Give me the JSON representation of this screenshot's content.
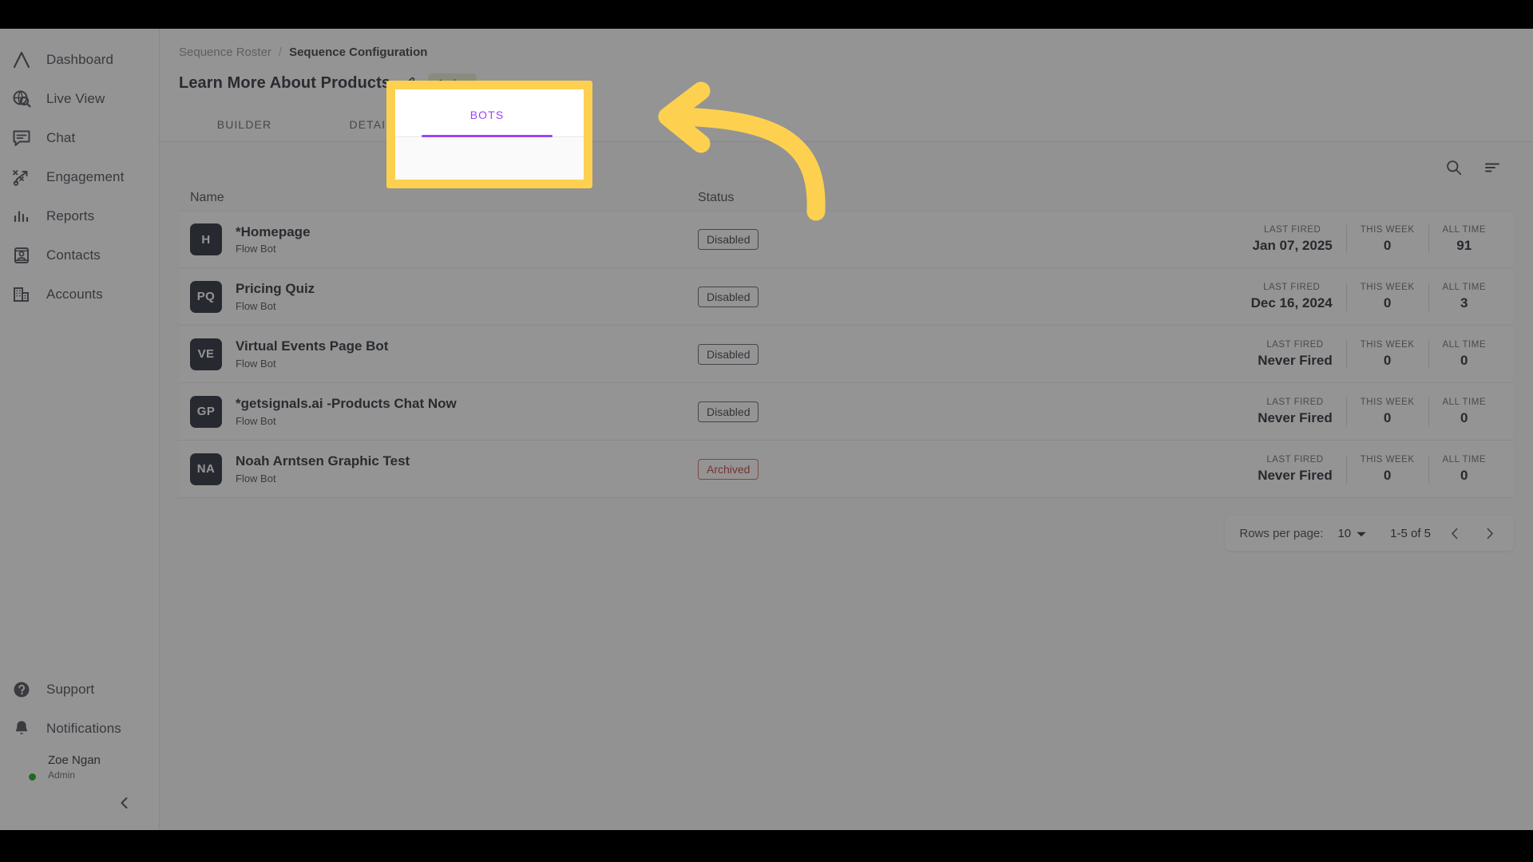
{
  "theme": {
    "accent_purple": "#9b45f5",
    "highlight_yellow": "#fdd14f",
    "active_badge_green": "#4b7a19",
    "archived_red": "#c0392b",
    "online_dot_green": "#12a312"
  },
  "sidebar": {
    "items": [
      {
        "label": "Dashboard",
        "icon": "chevron-up-logo-icon"
      },
      {
        "label": "Live View",
        "icon": "globe-search-icon"
      },
      {
        "label": "Chat",
        "icon": "chat-bubble-icon"
      },
      {
        "label": "Engagement",
        "icon": "engagement-path-icon"
      },
      {
        "label": "Reports",
        "icon": "bar-chart-icon"
      },
      {
        "label": "Contacts",
        "icon": "contact-card-icon"
      },
      {
        "label": "Accounts",
        "icon": "building-icon"
      }
    ],
    "bottom_items": [
      {
        "label": "Support",
        "icon": "help-circle-icon"
      },
      {
        "label": "Notifications",
        "icon": "bell-icon"
      }
    ],
    "user": {
      "name": "Zoe Ngan",
      "role": "Admin",
      "status": "online"
    },
    "collapse_icon": "chevron-left-icon"
  },
  "header": {
    "breadcrumb": {
      "parent": "Sequence Roster",
      "separator": "/",
      "current": "Sequence Configuration"
    },
    "page_title": "Learn More About Products",
    "edit_icon": "pencil-icon",
    "status_badge": "Active"
  },
  "tabs": {
    "items": [
      {
        "label": "BUILDER",
        "active": false
      },
      {
        "label": "DETAILS",
        "active": false
      },
      {
        "label": "BOTS",
        "active": true
      }
    ]
  },
  "toolbar": {
    "search_icon": "search-icon",
    "filter_icon": "sort-filter-icon"
  },
  "table": {
    "columns": {
      "name": "Name",
      "status": "Status",
      "last_fired": "LAST FIRED",
      "this_week": "THIS WEEK",
      "all_time": "ALL TIME"
    },
    "rows": [
      {
        "initials": "H",
        "name": "*Homepage",
        "type": "Flow Bot",
        "status": "Disabled",
        "status_kind": "disabled",
        "last_fired": "Jan 07, 2025",
        "this_week": "0",
        "all_time": "91"
      },
      {
        "initials": "PQ",
        "name": "Pricing Quiz",
        "type": "Flow Bot",
        "status": "Disabled",
        "status_kind": "disabled",
        "last_fired": "Dec 16, 2024",
        "this_week": "0",
        "all_time": "3"
      },
      {
        "initials": "VE",
        "name": "Virtual Events Page Bot",
        "type": "Flow Bot",
        "status": "Disabled",
        "status_kind": "disabled",
        "last_fired": "Never Fired",
        "this_week": "0",
        "all_time": "0"
      },
      {
        "initials": "GP",
        "name": "*getsignals.ai -Products Chat Now",
        "type": "Flow Bot",
        "status": "Disabled",
        "status_kind": "disabled",
        "last_fired": "Never Fired",
        "this_week": "0",
        "all_time": "0"
      },
      {
        "initials": "NA",
        "name": "Noah Arntsen Graphic Test",
        "type": "Flow Bot",
        "status": "Archived",
        "status_kind": "archived",
        "last_fired": "Never Fired",
        "this_week": "0",
        "all_time": "0"
      }
    ]
  },
  "pagination": {
    "rows_per_page_label": "Rows per page:",
    "rows_per_page_value": "10",
    "dropdown_icon": "caret-down-icon",
    "range": "1-5 of 5",
    "prev_icon": "chevron-left-icon",
    "next_icon": "chevron-right-icon"
  },
  "annotation": {
    "highlight_target": "BOTS",
    "arrow_icon": "curved-arrow-left-icon"
  }
}
